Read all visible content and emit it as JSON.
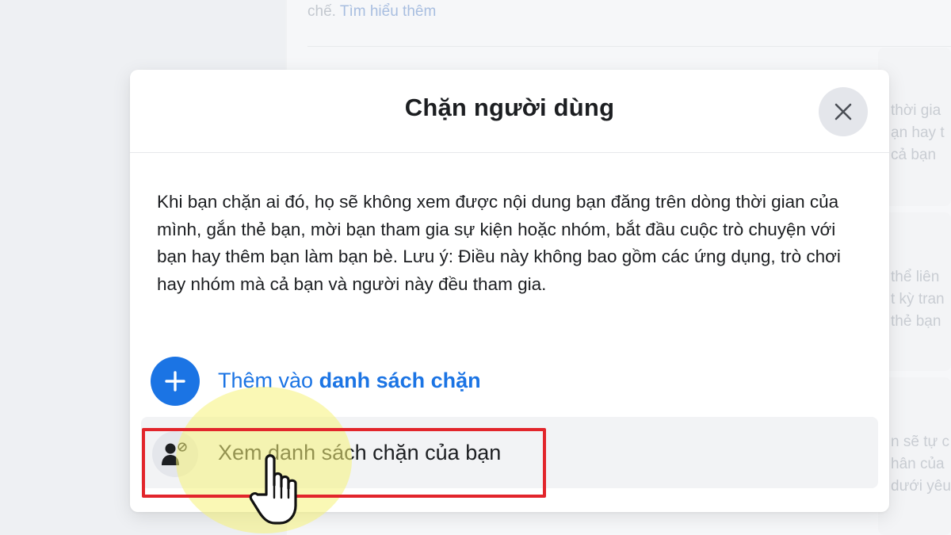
{
  "background": {
    "top_text": "chế.",
    "top_link": "Tìm hiểu thêm",
    "snippets": [
      "thời gia",
      "ạn hay t",
      "cả bạn",
      "thể liên",
      "t kỳ tran",
      "thẻ bạn",
      "n sẽ tự c",
      "hân của",
      "dưới yêu"
    ]
  },
  "dialog": {
    "title": "Chặn người dùng",
    "close_icon": "close-icon",
    "description": "Khi bạn chặn ai đó, họ sẽ không xem được nội dung bạn đăng trên dòng thời gian của mình, gắn thẻ bạn, mời bạn tham gia sự kiện hoặc nhóm, bắt đầu cuộc trò chuyện với bạn hay thêm bạn làm bạn bè. Lưu ý: Điều này không bao gồm các ứng dụng, trò chơi hay nhóm mà cả bạn và người này đều tham gia.",
    "add_option": {
      "icon": "plus-icon",
      "label_prefix": "Thêm vào",
      "label_bold": "danh sách chặn"
    },
    "view_option": {
      "icon": "person-blocked-icon",
      "label": "Xem danh sách chặn của bạn"
    }
  },
  "colors": {
    "accent": "#1b74e4",
    "annotation_red": "#e2252b",
    "annotation_highlight": "#f6f378"
  }
}
